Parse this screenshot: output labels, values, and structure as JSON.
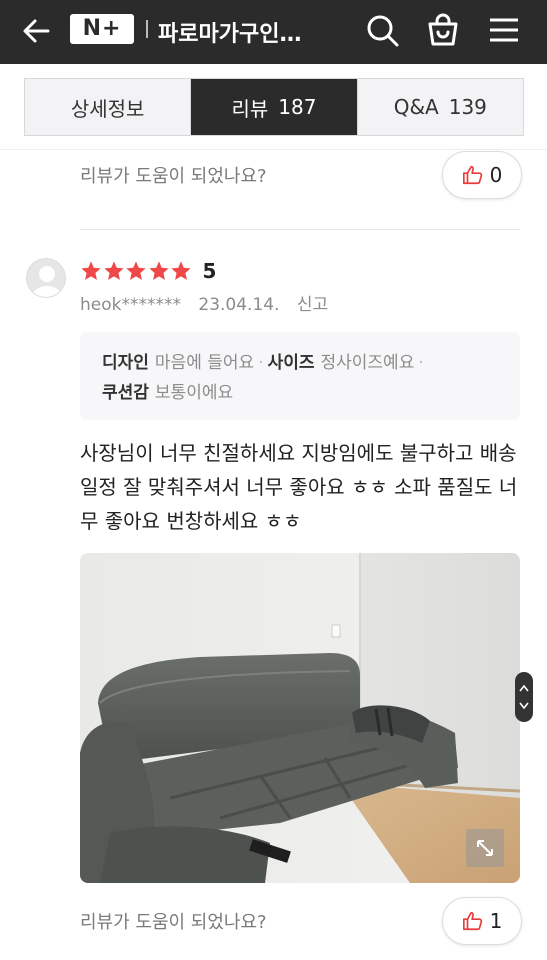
{
  "header": {
    "logo_text": "N+",
    "title": "파로마가구인…"
  },
  "tabs": [
    {
      "label": "상세정보",
      "count": ""
    },
    {
      "label": "리뷰",
      "count": "187"
    },
    {
      "label": "Q&A",
      "count": "139"
    }
  ],
  "prev_review": {
    "helpful_text": "리뷰가 도움이 되었나요?",
    "like_count": "0"
  },
  "review": {
    "rating": "5",
    "stars": 5,
    "user": "heok*******",
    "date": "23.04.14.",
    "report": "신고",
    "options": [
      {
        "key": "디자인",
        "value": "마음에 들어요"
      },
      {
        "key": "사이즈",
        "value": "정사이즈예요"
      },
      {
        "key": "쿠션감",
        "value": "보통이에요"
      }
    ],
    "content": "사장님이 너무 친절하세요 지방임에도 불구하고 배송일정 잘 맞춰주셔서 너무 좋아요 ㅎㅎ 소파 품질도 너무 좋아요 번창하세요 ㅎㅎ",
    "helpful_text": "리뷰가 도움이 되었나요?",
    "like_count": "1"
  },
  "colors": {
    "header_bg": "#2b2b2b",
    "star": "#f04848",
    "like_icon": "#e83a3a"
  }
}
